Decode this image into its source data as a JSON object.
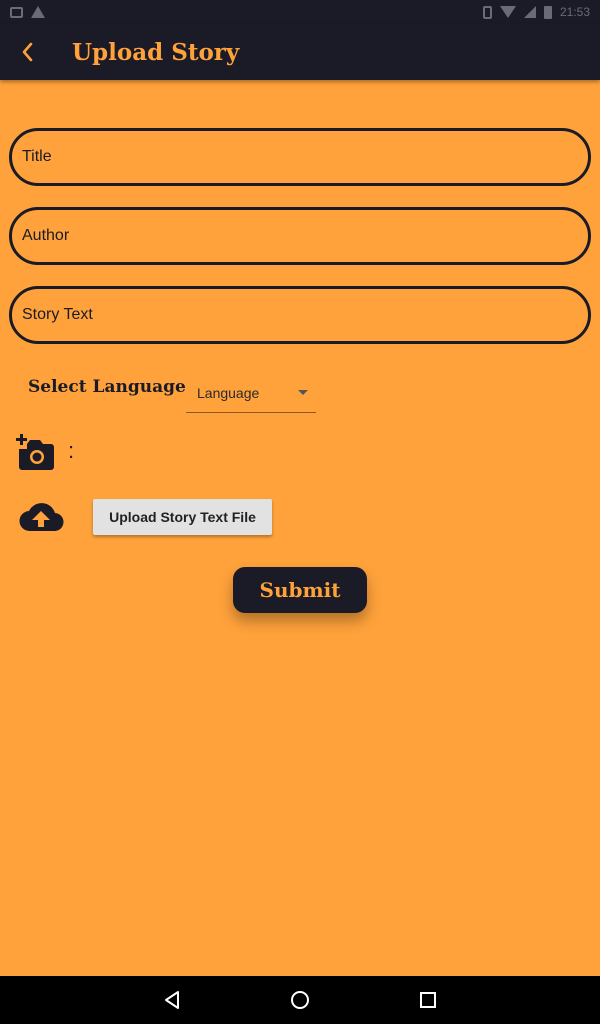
{
  "status_bar": {
    "time": "21:53"
  },
  "app_bar": {
    "title": "Upload Story",
    "back_icon": "chevron-left-icon"
  },
  "form": {
    "title_placeholder": "Title",
    "author_placeholder": "Author",
    "story_placeholder": "Story Text",
    "language_label": "Select Language",
    "language_value": "Language",
    "photo_separator": ":",
    "upload_button_label": "Upload Story Text File",
    "submit_label": "Submit"
  },
  "colors": {
    "accent": "#ffa23b",
    "dark": "#1b1b27",
    "button_grey": "#e2e2e2"
  }
}
